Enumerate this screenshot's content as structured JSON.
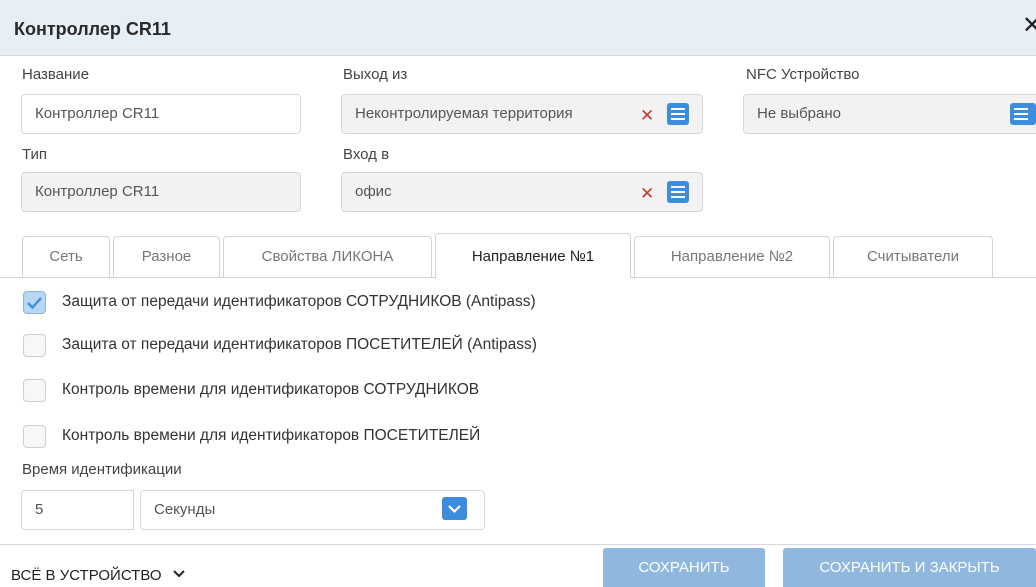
{
  "dialog": {
    "title": "Контроллер CR11"
  },
  "fields": {
    "name": {
      "label": "Название",
      "value": "Контроллер CR11"
    },
    "type": {
      "label": "Тип",
      "value": "Контроллер CR11"
    },
    "exit_from": {
      "label": "Выход из",
      "value": "Неконтролируемая территория"
    },
    "enter_to": {
      "label": "Вход в",
      "value": "офис"
    },
    "nfc_device": {
      "label": "NFC Устройство",
      "value": "Не выбрано"
    }
  },
  "tabs": [
    {
      "label": "Сеть",
      "active": false
    },
    {
      "label": "Разное",
      "active": false
    },
    {
      "label": "Свойства ЛИКОНА",
      "active": false
    },
    {
      "label": "Направление №1",
      "active": true
    },
    {
      "label": "Направление №2",
      "active": false
    },
    {
      "label": "Считыватели",
      "active": false
    }
  ],
  "checkboxes": [
    {
      "label": "Защита от передачи идентификаторов СОТРУДНИКОВ (Antipass)",
      "checked": true
    },
    {
      "label": "Защита от передачи идентификаторов ПОСЕТИТЕЛЕЙ (Antipass)",
      "checked": false
    },
    {
      "label": "Контроль времени для идентификаторов СОТРУДНИКОВ",
      "checked": false
    },
    {
      "label": "Контроль времени для идентификаторов ПОСЕТИТЕЛЕЙ",
      "checked": false
    }
  ],
  "ident_time": {
    "label": "Время идентификации",
    "value": "5",
    "unit": "Секунды"
  },
  "footer": {
    "all_to_device": "ВСЁ В УСТРОЙСТВО",
    "save": "СОХРАНИТЬ",
    "save_close": "СОХРАНИТЬ И ЗАКРЫТЬ"
  },
  "colors": {
    "accent": "#3c8dde",
    "header_bg": "#e6eef6",
    "button_bg": "#90b7de",
    "clear_x": "#c0392b"
  },
  "icons": [
    "close-icon",
    "clear-icon",
    "list-icon",
    "check-icon",
    "chevron-down-icon"
  ]
}
